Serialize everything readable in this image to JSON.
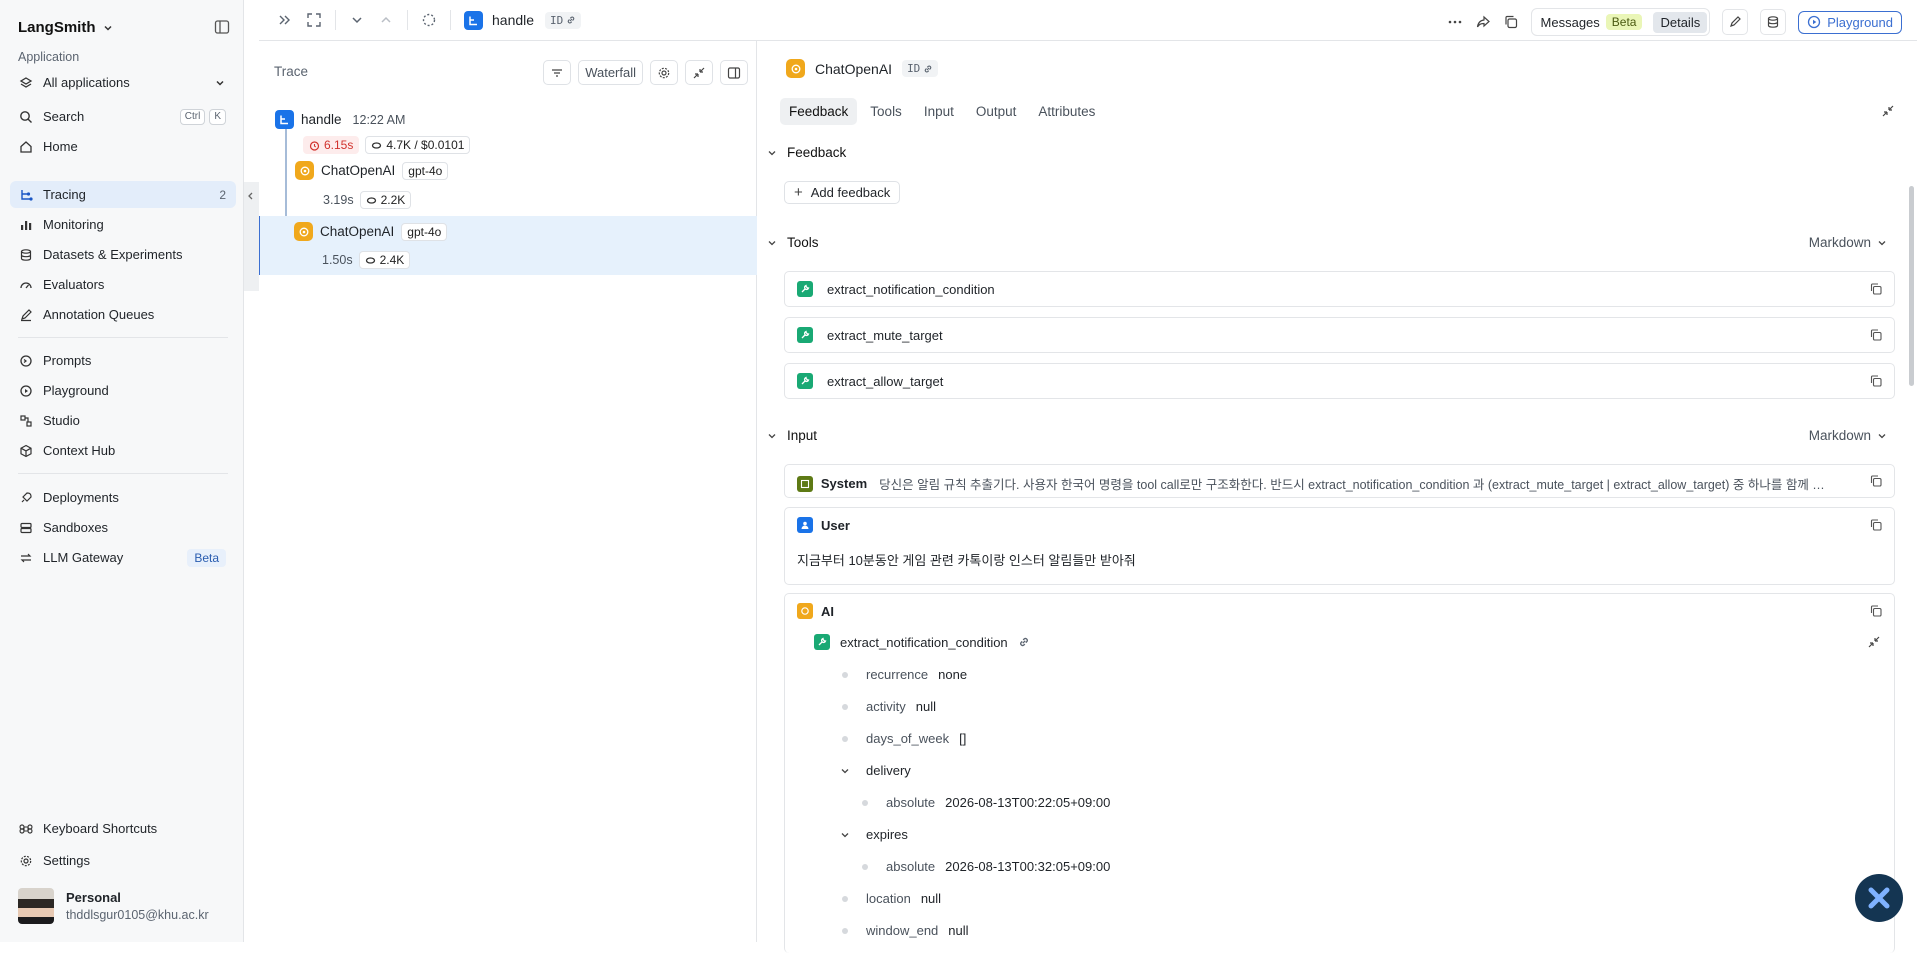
{
  "sidebar": {
    "brand": "LangSmith",
    "app_label": "Application",
    "app_select": "All applications",
    "search": {
      "label": "Search",
      "kbd1": "Ctrl",
      "kbd2": "K"
    },
    "home": "Home",
    "tracing": {
      "label": "Tracing",
      "count": "2"
    },
    "monitoring": "Monitoring",
    "datasets": "Datasets & Experiments",
    "evaluators": "Evaluators",
    "annotation": "Annotation Queues",
    "prompts": "Prompts",
    "playground": "Playground",
    "studio": "Studio",
    "context_hub": "Context Hub",
    "deployments": "Deployments",
    "sandboxes": "Sandboxes",
    "llm_gateway": {
      "label": "LLM Gateway",
      "badge": "Beta"
    },
    "shortcuts": "Keyboard Shortcuts",
    "settings": "Settings",
    "user": {
      "name": "Personal",
      "email": "thddlsgur0105@khu.ac.kr"
    }
  },
  "topbar": {
    "run_name": "handle",
    "id_label": "ID",
    "messages_label": "Messages",
    "messages_badge": "Beta",
    "details_label": "Details",
    "playground_label": "Playground"
  },
  "trace": {
    "title": "Trace",
    "view_mode": "Waterfall",
    "root": {
      "name": "handle",
      "time": "12:22 AM",
      "latency": "6.15s",
      "tokens": "4.7K / $0.0101"
    },
    "children": [
      {
        "name": "ChatOpenAI",
        "model": "gpt-4o",
        "latency": "3.19s",
        "tokens": "2.2K"
      },
      {
        "name": "ChatOpenAI",
        "model": "gpt-4o",
        "latency": "1.50s",
        "tokens": "2.4K"
      }
    ]
  },
  "detail": {
    "title": "ChatOpenAI",
    "id_label": "ID",
    "tabs": [
      "Feedback",
      "Tools",
      "Input",
      "Output",
      "Attributes"
    ],
    "feedback_section": "Feedback",
    "add_feedback": "Add feedback",
    "tools_section": "Tools",
    "tools_format": "Markdown",
    "tools": [
      "extract_notification_condition",
      "extract_mute_target",
      "extract_allow_target"
    ],
    "input_section": "Input",
    "input_format": "Markdown",
    "system": {
      "role": "System",
      "text": "당신은 알림 규칙 추출기다. 사용자 한국어 명령을 tool call로만 구조화한다. 반드시 extract_notification_condition 과 (extract_mute_target | extract_allow_target) 중 하나를 함께 호..."
    },
    "user": {
      "role": "User",
      "text": "지금부터 10분동안 게임 관련 카톡이랑 인스터 알림들만 받아줘"
    },
    "ai": {
      "role": "AI",
      "tool_call": "extract_notification_condition",
      "fields": {
        "recurrence": {
          "k": "recurrence",
          "v": "none"
        },
        "activity": {
          "k": "activity",
          "v": "null"
        },
        "days_of_week": {
          "k": "days_of_week",
          "v": "[]"
        },
        "delivery": {
          "k": "delivery"
        },
        "delivery_absolute": {
          "k": "absolute",
          "v": "2026-08-13T00:22:05+09:00"
        },
        "expires": {
          "k": "expires"
        },
        "expires_absolute": {
          "k": "absolute",
          "v": "2026-08-13T00:32:05+09:00"
        },
        "location": {
          "k": "location",
          "v": "null"
        },
        "window_end": {
          "k": "window_end",
          "v": "null"
        }
      }
    }
  },
  "colors": {
    "accent": "#1a73e8",
    "openai_icon": "#f0a81c",
    "tool_icon": "#19a974",
    "selected_row": "#e6f1fc",
    "latency_red": "#d1322d"
  }
}
